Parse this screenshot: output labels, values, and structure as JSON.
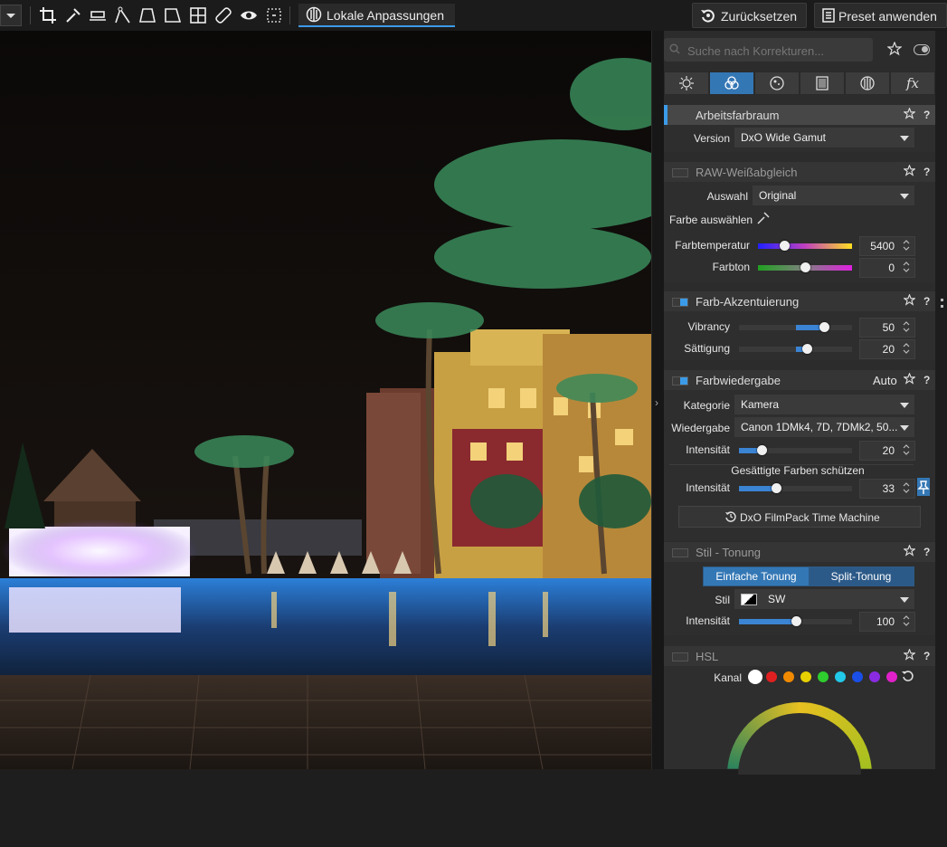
{
  "toolbar": {
    "local_adjustments_label": "Lokale Anpassungen",
    "reset_label": "Zurücksetzen",
    "preset_label": "Preset anwenden",
    "tools": [
      "crop-icon",
      "eyedropper-icon",
      "level-icon",
      "polygon-icon",
      "perspective-icon",
      "perspective-rect-icon",
      "grid-icon",
      "repair-icon",
      "eye-icon",
      "selection-icon"
    ]
  },
  "panel": {
    "search_placeholder": "Suche nach Korrekturen...",
    "tabs": [
      "sun-icon",
      "color-circles-icon",
      "detail-icon",
      "geometry-icon",
      "local-icon",
      "fx-icon"
    ],
    "sections": {
      "working_space": {
        "title": "Arbeitsfarbraum",
        "version_label": "Version",
        "version_value": "DxO Wide Gamut"
      },
      "raw_wb": {
        "title": "RAW-Weißabgleich",
        "selection_label": "Auswahl",
        "selection_value": "Original",
        "pick_color_label": "Farbe auswählen",
        "temperature_label": "Farbtemperatur",
        "temperature_value": "5400",
        "temperature_fraction": 0.28,
        "tint_label": "Farbton",
        "tint_value": "0",
        "tint_fraction": 0.5
      },
      "color_accent": {
        "title": "Farb-Akzentuierung",
        "vibrancy_label": "Vibrancy",
        "vibrancy_value": "50",
        "vibrancy_fraction": 0.75,
        "saturation_label": "Sättigung",
        "saturation_value": "20",
        "saturation_fraction": 0.6
      },
      "color_rendering": {
        "title": "Farbwiedergabe",
        "auto_label": "Auto",
        "category_label": "Kategorie",
        "category_value": "Kamera",
        "rendering_label": "Wiedergabe",
        "rendering_value": "Canon 1DMk4, 7D, 7DMk2, 50...",
        "intensity_label": "Intensität",
        "intensity_value": "20",
        "intensity_fraction": 0.2,
        "protect_label": "Gesättigte Farben schützen",
        "protect_intensity_label": "Intensität",
        "protect_intensity_value": "33",
        "protect_fraction": 0.33,
        "filmpack_label": "DxO FilmPack Time Machine"
      },
      "toning": {
        "title": "Stil - Tonung",
        "simple_label": "Einfache Tonung",
        "split_label": "Split-Tonung",
        "style_label": "Stil",
        "style_value": "SW",
        "intensity_label": "Intensität",
        "intensity_value": "100",
        "intensity_fraction": 0.5
      },
      "hsl": {
        "title": "HSL",
        "channel_label": "Kanal",
        "channel_colors": [
          "#ffffff",
          "#e02020",
          "#f08a00",
          "#e8d000",
          "#2ecc2e",
          "#22c8e8",
          "#1a4fe8",
          "#8a2be2",
          "#e020c8"
        ]
      }
    }
  }
}
